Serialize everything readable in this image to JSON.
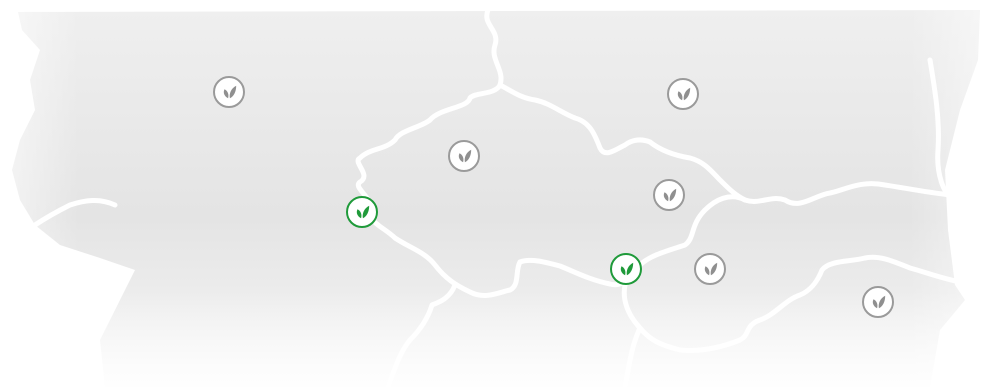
{
  "map": {
    "colors": {
      "land": "#e6e6e6",
      "border": "#ffffff",
      "marker_active": "#1f9a3a",
      "marker_inactive": "#9a9a9a"
    },
    "markers": [
      {
        "id": "marker-1",
        "status": "inactive",
        "icon": "leaf-icon"
      },
      {
        "id": "marker-2",
        "status": "inactive",
        "icon": "leaf-icon"
      },
      {
        "id": "marker-3",
        "status": "inactive",
        "icon": "leaf-icon"
      },
      {
        "id": "marker-4",
        "status": "active",
        "icon": "leaf-icon"
      },
      {
        "id": "marker-5",
        "status": "inactive",
        "icon": "leaf-icon"
      },
      {
        "id": "marker-6",
        "status": "inactive",
        "icon": "leaf-icon"
      },
      {
        "id": "marker-7",
        "status": "active",
        "icon": "leaf-icon"
      },
      {
        "id": "marker-8",
        "status": "inactive",
        "icon": "leaf-icon"
      }
    ]
  }
}
